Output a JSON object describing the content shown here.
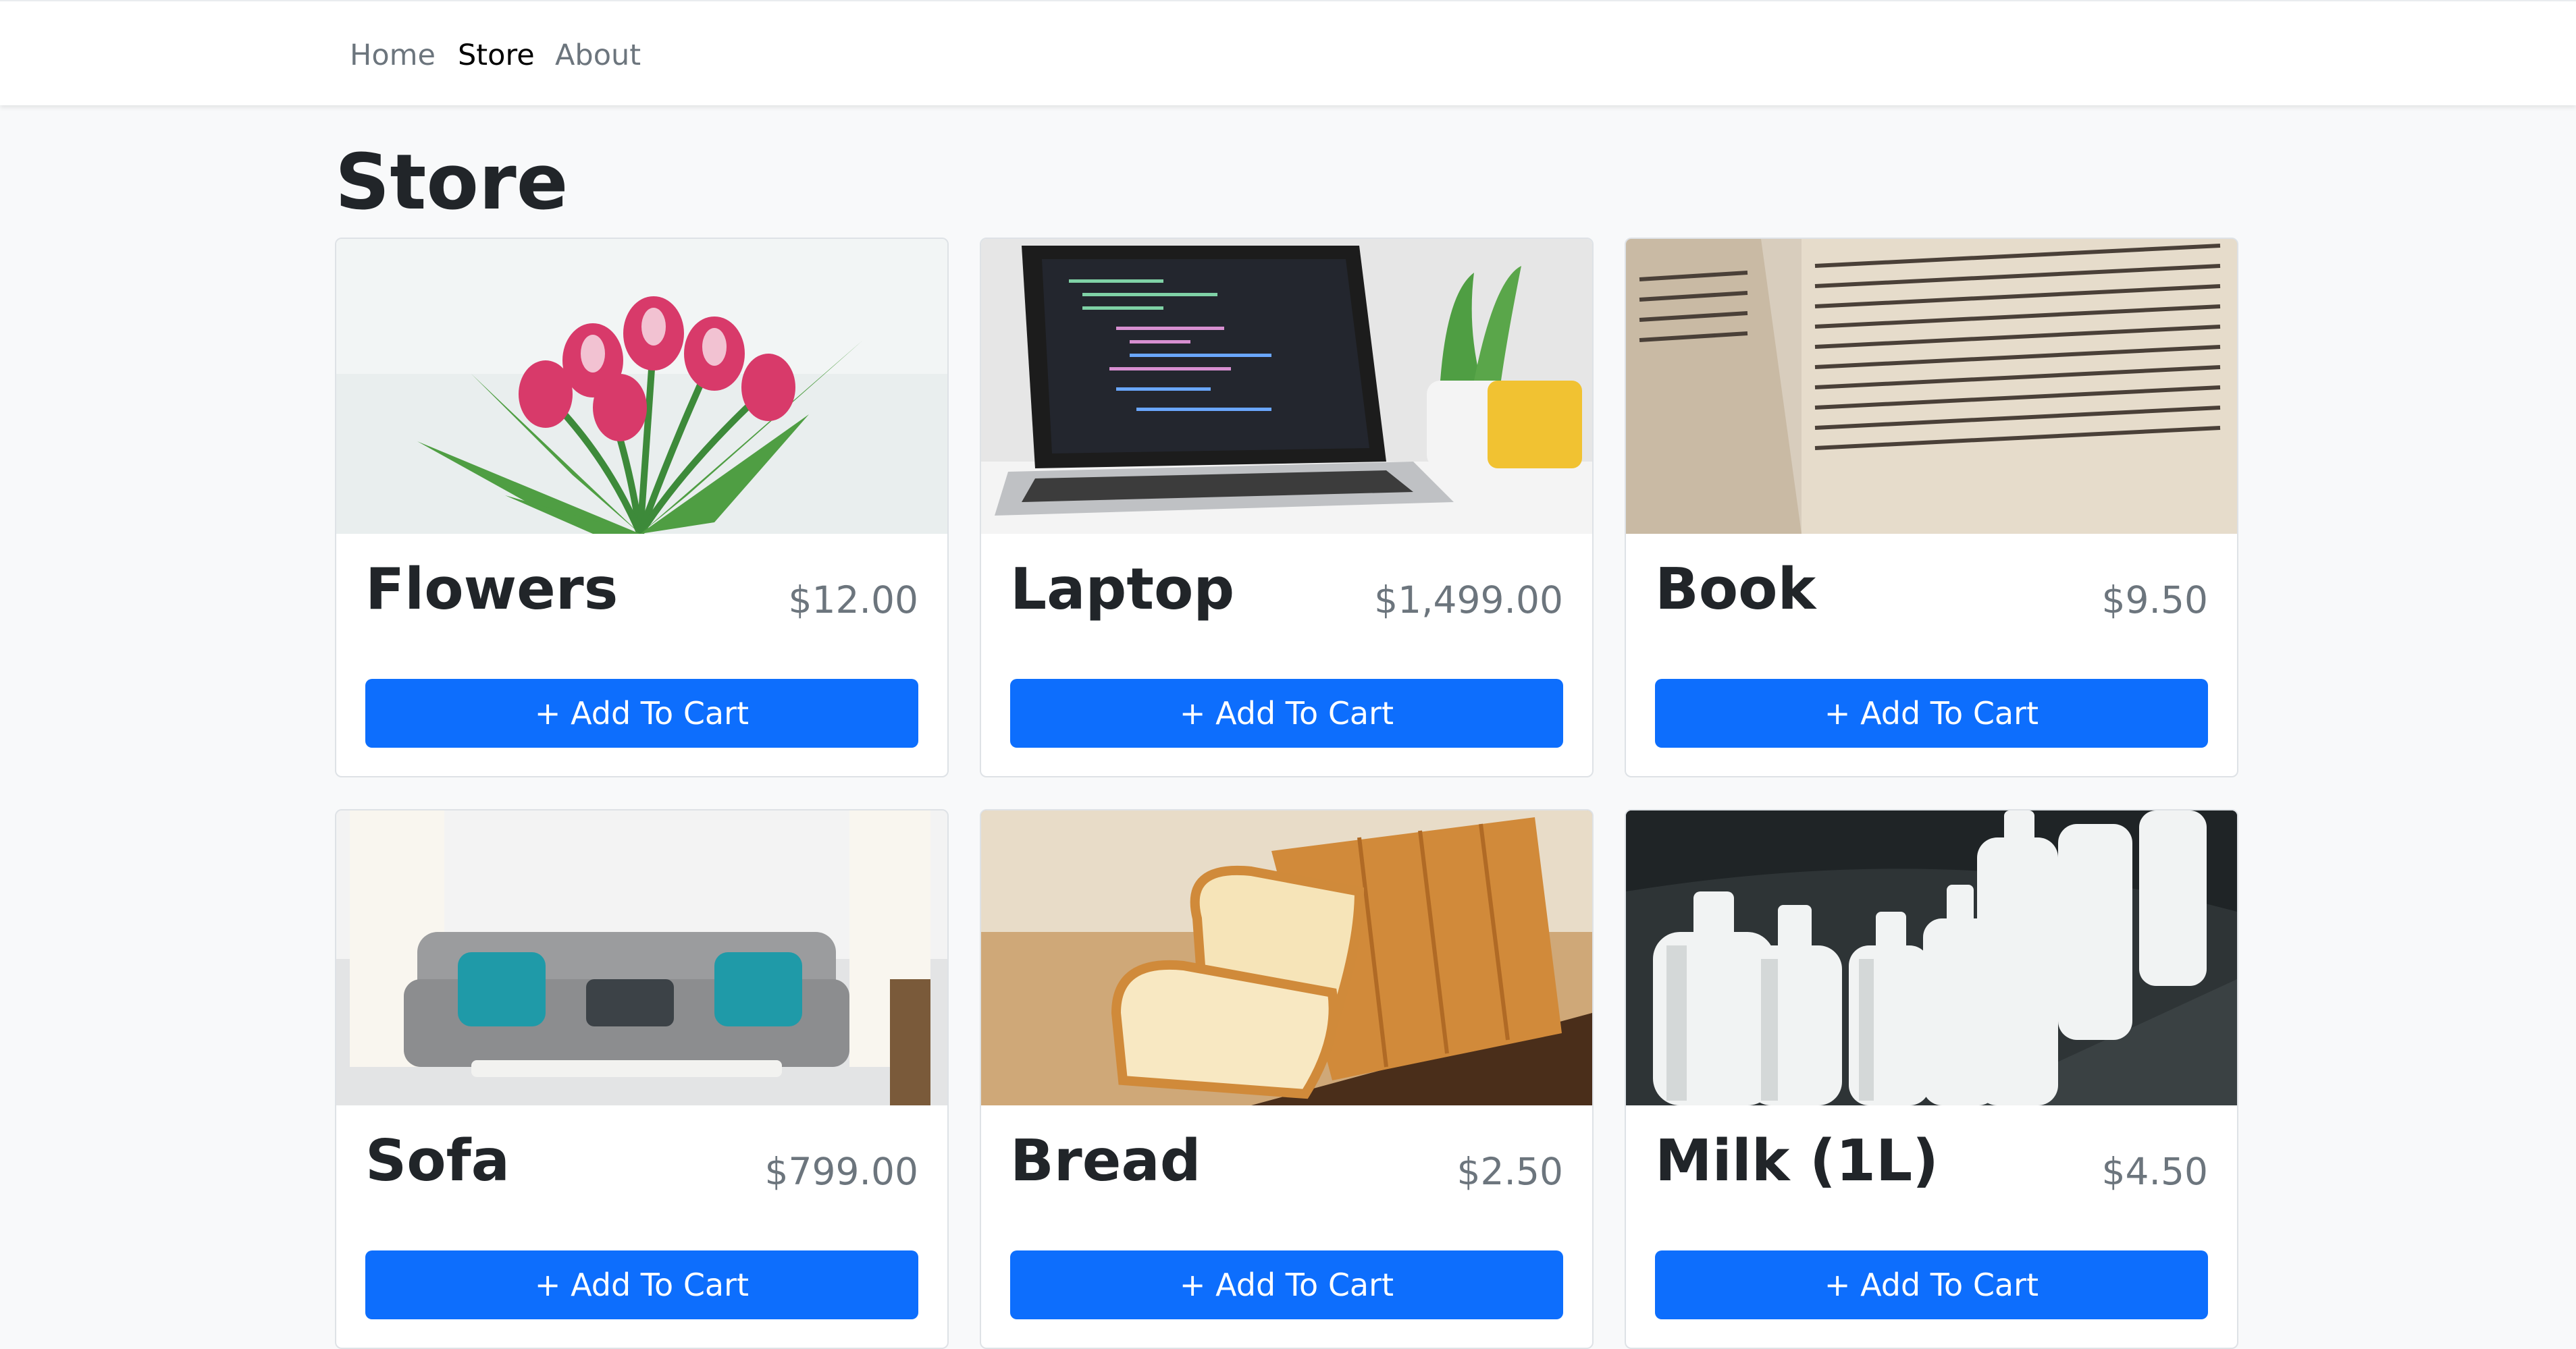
{
  "nav": {
    "items": [
      {
        "label": "Home",
        "active": false
      },
      {
        "label": "Store",
        "active": true
      },
      {
        "label": "About",
        "active": false
      }
    ]
  },
  "page": {
    "title": "Store"
  },
  "products": [
    {
      "name": "Flowers",
      "price": "$12.00",
      "button": "+ Add To Cart",
      "image": "flowers-image"
    },
    {
      "name": "Laptop",
      "price": "$1,499.00",
      "button": "+ Add To Cart",
      "image": "laptop-image"
    },
    {
      "name": "Book",
      "price": "$9.50",
      "button": "+ Add To Cart",
      "image": "book-image"
    },
    {
      "name": "Sofa",
      "price": "$799.00",
      "button": "+ Add To Cart",
      "image": "sofa-image"
    },
    {
      "name": "Bread",
      "price": "$2.50",
      "button": "+ Add To Cart",
      "image": "bread-image"
    },
    {
      "name": "Milk (1L)",
      "price": "$4.50",
      "button": "+ Add To Cart",
      "image": "milk-image"
    }
  ],
  "colors": {
    "primary": "#0d6efd",
    "background": "#f8f9fa",
    "nav_active": "#000000",
    "nav_inactive": "#6c757d"
  }
}
